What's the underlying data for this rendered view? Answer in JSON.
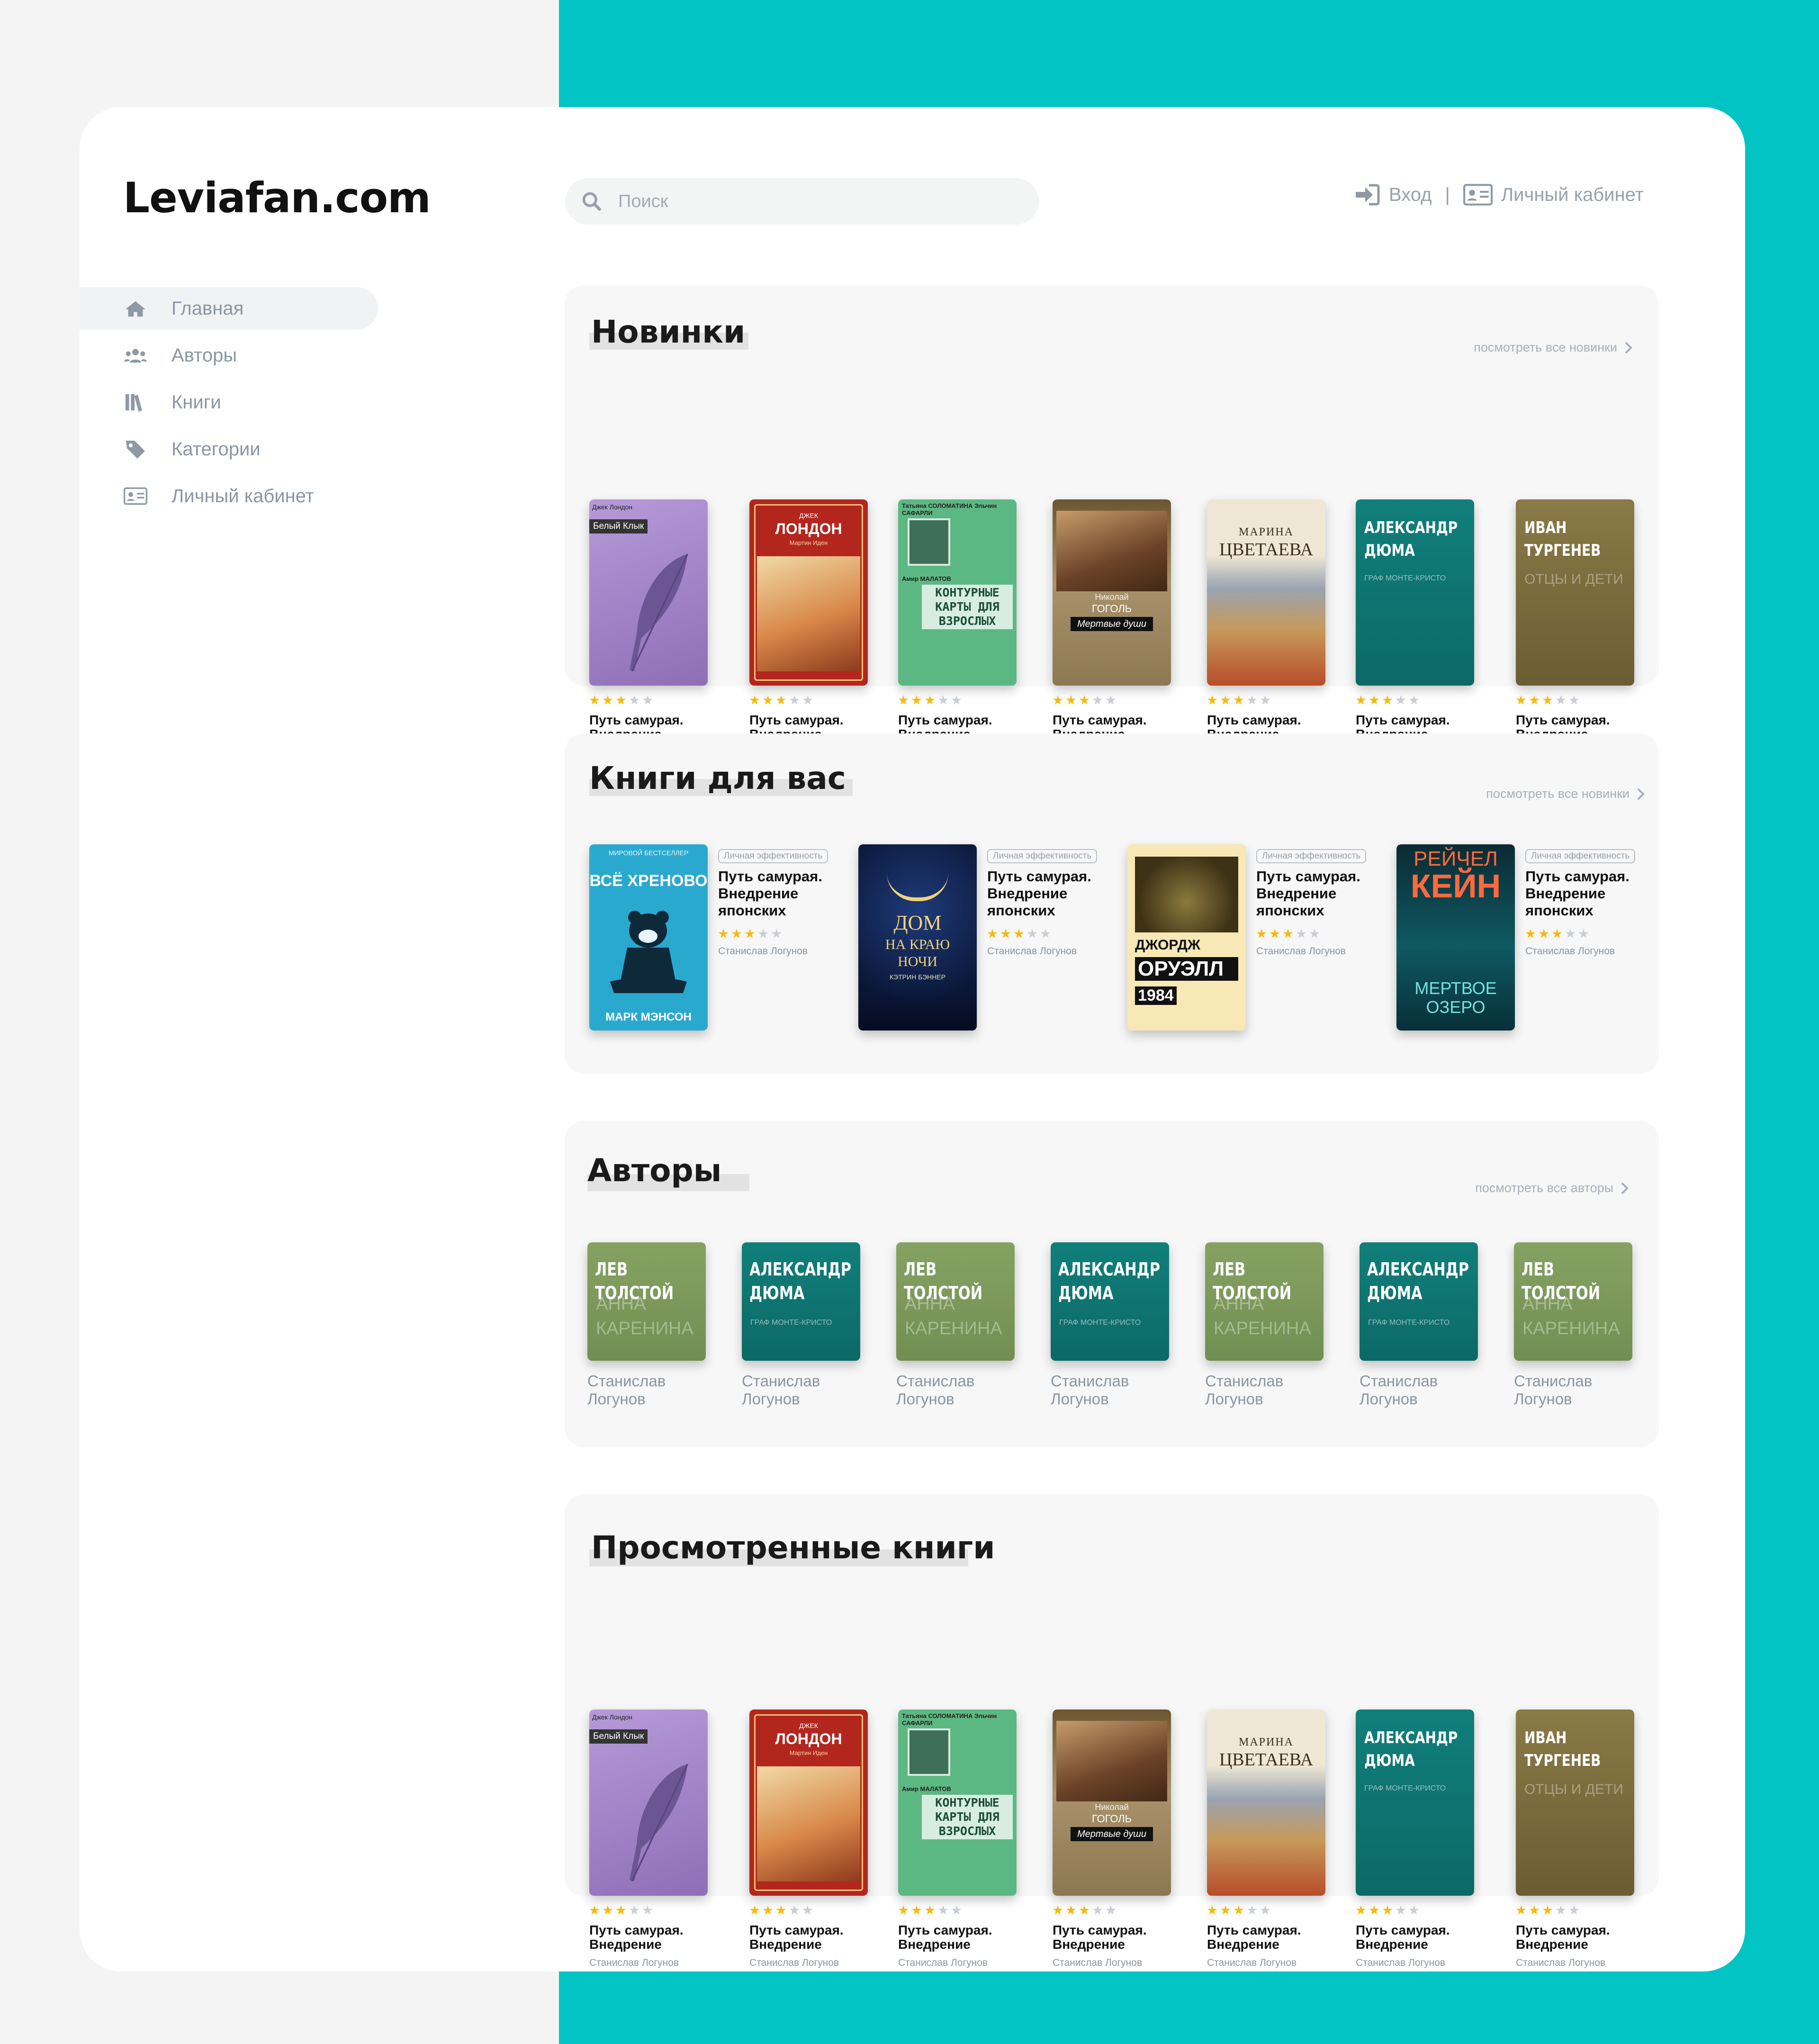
{
  "brand": "Leviafan.com",
  "search": {
    "placeholder": "Поиск"
  },
  "top": {
    "login": "Вход",
    "separator": "|",
    "cabinet": "Личный кабинет"
  },
  "nav": [
    {
      "label": "Главная",
      "icon": "home-icon",
      "active": true
    },
    {
      "label": "Авторы",
      "icon": "users-icon"
    },
    {
      "label": "Книги",
      "icon": "books-icon"
    },
    {
      "label": "Категории",
      "icon": "tag-icon"
    },
    {
      "label": "Личный кабинет",
      "icon": "id-card-icon"
    }
  ],
  "sections": {
    "new": {
      "title": "Новинки",
      "see_all": "посмотреть все новинки"
    },
    "for_you": {
      "title": "Книги для вас",
      "see_all": "посмотреть все новинки"
    },
    "authors": {
      "title": "Авторы",
      "see_all": "посмотреть все авторы"
    },
    "viewed": {
      "title": "Просмотренные книги"
    }
  },
  "books": [
    {
      "title": "Путь самурая. Внедрение",
      "author": "Станислав Логунов",
      "rating": 3,
      "cover": {
        "top": "Джек Лондон",
        "main": "Белый Клык",
        "sub": ""
      }
    },
    {
      "title": "Путь самурая. Внедрение",
      "author": "Станислав Логунов",
      "rating": 3,
      "cover": {
        "top": "ДЖЕК",
        "main": "ЛОНДОН",
        "sub": "Мартин Иден"
      }
    },
    {
      "title": "Путь самурая. Внедрение",
      "author": "Станислав Логунов",
      "rating": 3,
      "cover": {
        "top": "Татьяна СОЛОМАТИНА  Эльчин САФАРЛИ",
        "main": "КОНТУРНЫЕ КАРТЫ ДЛЯ ВЗРОСЛЫХ",
        "sub": "Амир МАЛАТОВ"
      }
    },
    {
      "title": "Путь самурая. Внедрение",
      "author": "Станислав Логунов",
      "rating": 3,
      "cover": {
        "top": "Николай",
        "main": "ГОГОЛЬ",
        "sub": "Мертвые души"
      }
    },
    {
      "title": "Путь самурая. Внедрение",
      "author": "Станислав Логунов",
      "rating": 3,
      "cover": {
        "top": "МАРИНА",
        "main": "ЦВЕТАЕВА",
        "sub": ""
      }
    },
    {
      "title": "Путь самурая. Внедрение",
      "author": "Станислав Логунов",
      "rating": 3,
      "cover": {
        "top": "АЛЕКСАНДР",
        "main": "ДЮМА",
        "sub": "ГРАФ МОНТЕ-КРИСТО"
      }
    },
    {
      "title": "Путь самурая. Внедрение",
      "author": "Станислав Логунов",
      "rating": 3,
      "cover": {
        "top": "ИВАН",
        "main": "ТУРГЕНЕВ",
        "sub": "ОТЦЫ И ДЕТИ"
      }
    }
  ],
  "recommended": [
    {
      "tag": "Личная эффективность",
      "title": "Путь самурая. Внедрение японских",
      "author": "Станислав Логунов",
      "rating": 3,
      "cover": {
        "top": "МИРОВОЙ БЕСТСЕЛЛЕР",
        "main": "ВСЁ ХРЕНОВО",
        "sub": "МАРК МЭНСОН"
      }
    },
    {
      "tag": "Личная эффективность",
      "title": "Путь самурая. Внедрение японских",
      "author": "Станислав Логунов",
      "rating": 3,
      "cover": {
        "top": "ДОМ",
        "main": "НА КРАЮ НОЧИ",
        "sub": "КЭТРИН БЭННЕР"
      }
    },
    {
      "tag": "Личная эффективность",
      "title": "Путь самурая. Внедрение японских",
      "author": "Станислав Логунов",
      "rating": 3,
      "cover": {
        "top": "ДЖОРДЖ",
        "main": "ОРУЭЛЛ",
        "sub": "1984"
      }
    },
    {
      "tag": "Личная эффективность",
      "title": "Путь самурая. Внедрение японских",
      "author": "Станислав Логунов",
      "rating": 3,
      "cover": {
        "top": "РЕЙЧЕЛ",
        "main": "КЕЙН",
        "sub": "МЕРТВОЕ ОЗЕРО"
      }
    }
  ],
  "authors": [
    {
      "name": "Станислав Логунов",
      "cover": {
        "main": "ЛЕВ ТОЛСТОЙ",
        "sub": "АННА КАРЕНИНА"
      }
    },
    {
      "name": "Станислав Логунов",
      "cover": {
        "main": "АЛЕКСАНДР ДЮМА",
        "sub": "ГРАФ МОНТЕ-КРИСТО"
      }
    },
    {
      "name": "Станислав Логунов",
      "cover": {
        "main": "ЛЕВ ТОЛСТОЙ",
        "sub": "АННА КАРЕНИНА"
      }
    },
    {
      "name": "Станислав Логунов",
      "cover": {
        "main": "АЛЕКСАНДР ДЮМА",
        "sub": "ГРАФ МОНТЕ-КРИСТО"
      }
    },
    {
      "name": "Станислав Логунов",
      "cover": {
        "main": "ЛЕВ ТОЛСТОЙ",
        "sub": "АННА КАРЕНИНА"
      }
    },
    {
      "name": "Станислав Логунов",
      "cover": {
        "main": "АЛЕКСАНДР ДЮМА",
        "sub": "ГРАФ МОНТЕ-КРИСТО"
      }
    },
    {
      "name": "Станислав Логунов",
      "cover": {
        "main": "ЛЕВ ТОЛСТОЙ",
        "sub": "АННА КАРЕНИНА"
      }
    }
  ],
  "colors": {
    "accent": "#03c4c4",
    "star": "#f5b90f",
    "teal_cover": "#0d8f8a",
    "olive_cover": "#7d9a5c"
  }
}
